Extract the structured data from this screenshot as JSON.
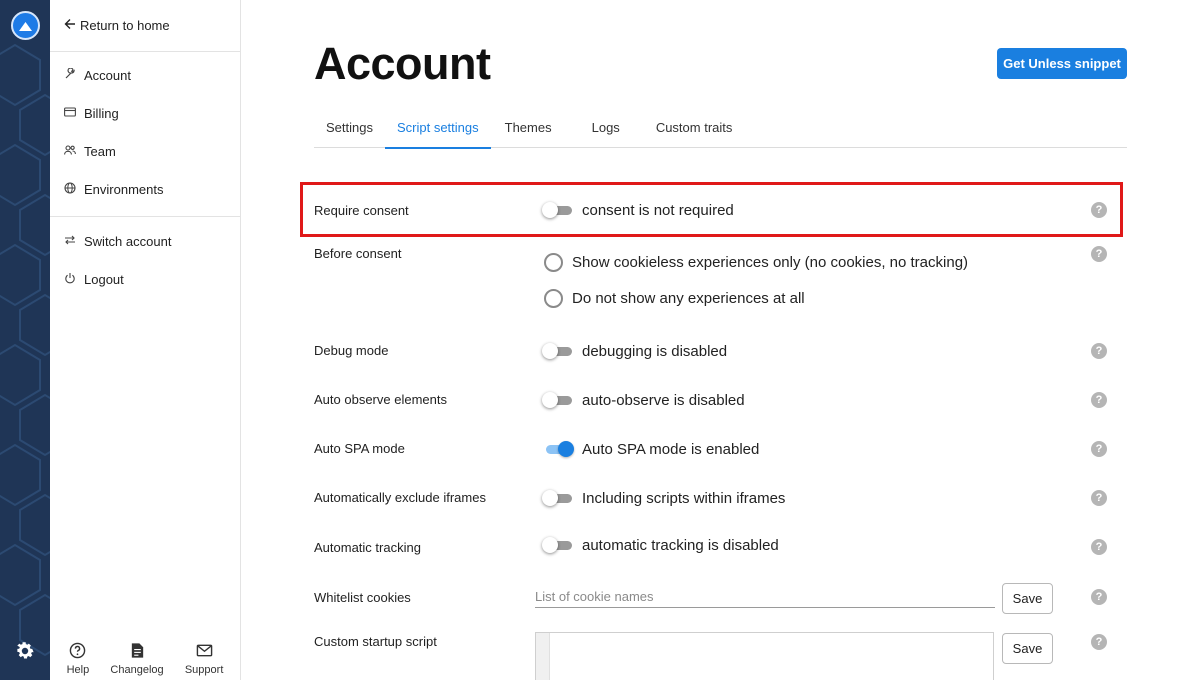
{
  "sidebar": {
    "back_label": "Return to home",
    "items": [
      {
        "label": "Account",
        "icon": "wrench-icon"
      },
      {
        "label": "Billing",
        "icon": "credit-card-icon"
      },
      {
        "label": "Team",
        "icon": "people-icon"
      },
      {
        "label": "Environments",
        "icon": "globe-icon"
      }
    ],
    "secondary": [
      {
        "label": "Switch account",
        "icon": "swap-arrows-icon"
      },
      {
        "label": "Logout",
        "icon": "power-icon"
      }
    ],
    "bottom": [
      {
        "label": "Help",
        "icon": "question-circle-icon"
      },
      {
        "label": "Changelog",
        "icon": "document-icon"
      },
      {
        "label": "Support",
        "icon": "mail-icon"
      }
    ]
  },
  "page": {
    "title": "Account",
    "snippet_button": "Get Unless snippet"
  },
  "tabs": [
    {
      "label": "Settings",
      "active": false
    },
    {
      "label": "Script settings",
      "active": true
    },
    {
      "label": "Themes",
      "active": false
    },
    {
      "label": "Logs",
      "active": false
    },
    {
      "label": "Custom traits",
      "active": false
    }
  ],
  "settings": {
    "require_consent": {
      "label": "Require consent",
      "value": "consent is not required",
      "enabled": false
    },
    "before_consent": {
      "label": "Before consent",
      "options": [
        "Show cookieless experiences only (no cookies, no tracking)",
        "Do not show any experiences at all"
      ]
    },
    "debug_mode": {
      "label": "Debug mode",
      "value": "debugging is disabled",
      "enabled": false
    },
    "auto_observe": {
      "label": "Auto observe elements",
      "value": "auto-observe is disabled",
      "enabled": false
    },
    "auto_spa": {
      "label": "Auto SPA mode",
      "value": "Auto SPA mode is enabled",
      "enabled": true
    },
    "exclude_iframes": {
      "label": "Automatically exclude iframes",
      "value": "Including scripts within iframes",
      "enabled": false
    },
    "auto_tracking": {
      "label": "Automatic tracking",
      "value": "automatic tracking is disabled",
      "enabled": false
    },
    "whitelist_cookies": {
      "label": "Whitelist cookies",
      "placeholder": "List of cookie names",
      "value": "",
      "save_label": "Save"
    },
    "custom_script": {
      "label": "Custom startup script",
      "save_label": "Save"
    }
  },
  "help_symbol": "?",
  "colors": {
    "accent": "#1a7fe0",
    "rail": "#1f3556",
    "highlight": "#e01818"
  }
}
